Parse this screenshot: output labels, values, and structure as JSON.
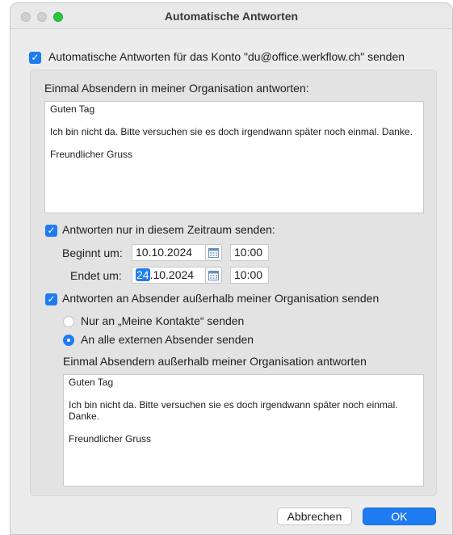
{
  "window": {
    "title": "Automatische Antworten"
  },
  "main_checkbox": {
    "label": "Automatische Antworten für das Konto \"du@office.werkflow.ch\" senden",
    "checked": true
  },
  "internal": {
    "heading": "Einmal Absendern in meiner Organisation antworten:",
    "message": [
      "Guten Tag",
      "",
      "Ich bin nicht da. Bitte versuchen sie es doch irgendwann später noch einmal. Danke.",
      "",
      "Freundlicher Gruss"
    ]
  },
  "schedule": {
    "checkbox_label": "Antworten nur in diesem Zeitraum senden:",
    "checked": true,
    "start_label": "Beginnt um:",
    "start_date": "10.10.2024",
    "start_time": "10:00",
    "end_label": "Endet um:",
    "end_date_day": "24",
    "end_date_rest": ".10.2024",
    "end_time": "10:00"
  },
  "external": {
    "checkbox_label": "Antworten an Absender außerhalb meiner Organisation senden",
    "checked": true,
    "radio_contacts": "Nur an „Meine Kontakte“ senden",
    "radio_all": "An alle externen Absender senden",
    "selected": "all",
    "heading": "Einmal Absendern außerhalb meiner Organisation antworten",
    "message": [
      "Guten Tag",
      "",
      "Ich bin nicht da. Bitte versuchen sie es doch irgendwann später noch einmal. Danke.",
      "",
      "Freundlicher Gruss"
    ]
  },
  "buttons": {
    "cancel": "Abbrechen",
    "ok": "OK"
  },
  "icons": {
    "checkbox": "checkmark-icon",
    "calendar": "calendar-icon"
  },
  "colors": {
    "accent": "#1f7cf0",
    "window_bg": "#ececec",
    "group_bg": "#e3e3e3"
  }
}
